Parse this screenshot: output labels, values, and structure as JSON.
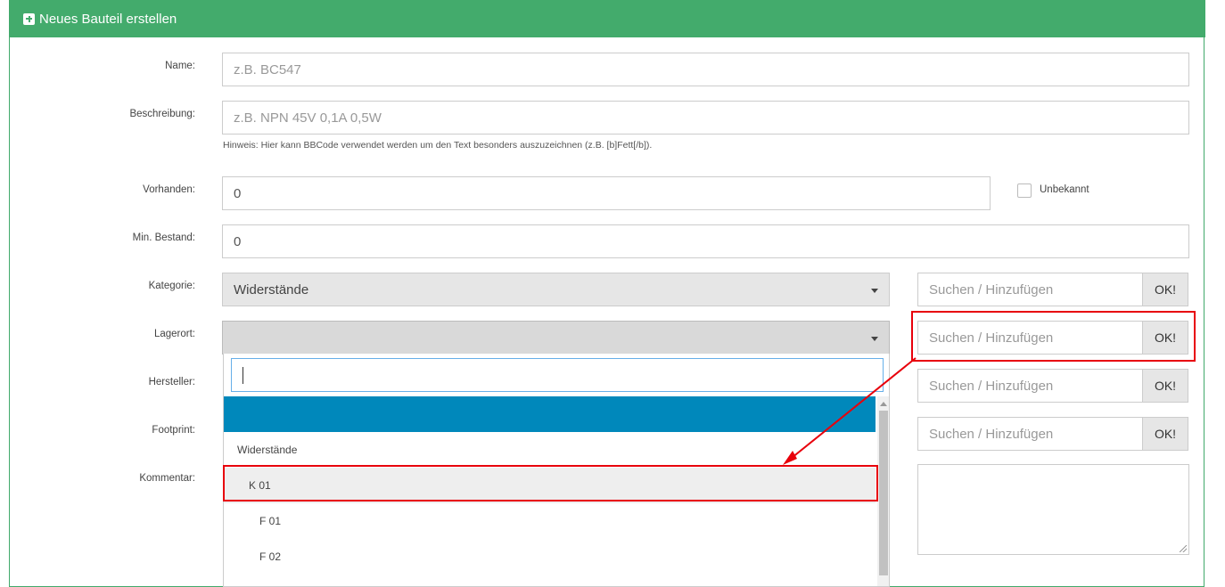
{
  "header": {
    "title": "Neues Bauteil erstellen",
    "icon": "plus-square-icon"
  },
  "form": {
    "name": {
      "label": "Name:",
      "placeholder": "z.B. BC547"
    },
    "description": {
      "label": "Beschreibung:",
      "placeholder": "z.B. NPN 45V 0,1A 0,5W",
      "hint": "Hinweis: Hier kann BBCode verwendet werden um den Text besonders auszuzeichnen (z.B. [b]Fett[/b])."
    },
    "instock": {
      "label": "Vorhanden:",
      "value": "0",
      "unknown_label": "Unbekannt",
      "unknown_checked": false
    },
    "mininstock": {
      "label": "Min. Bestand:",
      "value": "0"
    },
    "category": {
      "label": "Kategorie:",
      "value": "Widerstände",
      "search_placeholder": "Suchen / Hinzufügen",
      "ok_label": "OK!"
    },
    "storelocation": {
      "label": "Lagerort:",
      "value": "",
      "search_placeholder": "Suchen / Hinzufügen",
      "ok_label": "OK!"
    },
    "manufacturer": {
      "label": "Hersteller:",
      "search_placeholder": "Suchen / Hinzufügen",
      "ok_label": "OK!"
    },
    "footprint": {
      "label": "Footprint:",
      "search_placeholder": "Suchen / Hinzufügen",
      "ok_label": "OK!"
    },
    "comment": {
      "label": "Kommentar:",
      "value": ""
    }
  },
  "dropdown": {
    "search_value": "",
    "items": [
      {
        "label": "",
        "state": "highlighted"
      },
      {
        "label": "Widerstände",
        "state": "normal"
      },
      {
        "label": "K 01",
        "state": "active"
      },
      {
        "label": "F 01",
        "state": "normal"
      },
      {
        "label": "F 02",
        "state": "normal"
      }
    ]
  },
  "colors": {
    "header_bg": "#43ab6c",
    "highlight": "#0088bb",
    "annotation": "#e8000b"
  }
}
